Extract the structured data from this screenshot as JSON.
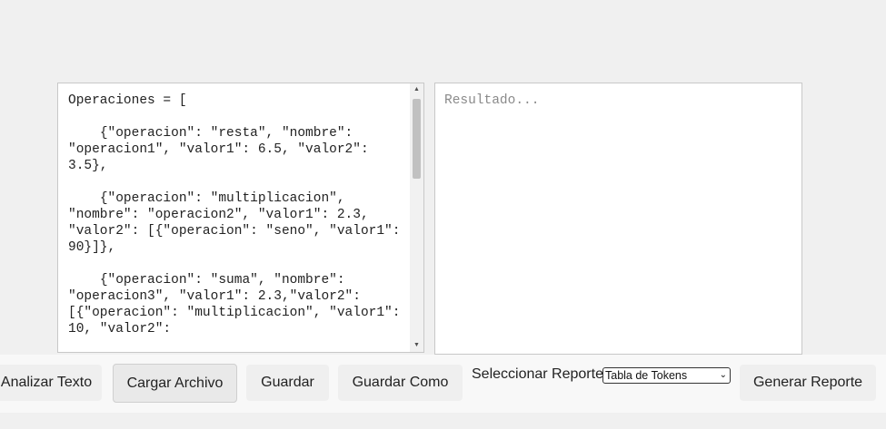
{
  "editor": {
    "content": "Operaciones = [\n\n    {\"operacion\": \"resta\", \"nombre\": \"operacion1\", \"valor1\": 6.5, \"valor2\": 3.5},\n\n    {\"operacion\": \"multiplicacion\", \"nombre\": \"operacion2\", \"valor1\": 2.3, \"valor2\": [{\"operacion\": \"seno\", \"valor1\": 90}]},\n\n    {\"operacion\": \"suma\", \"nombre\": \"operacion3\", \"valor1\": 2.3,\"valor2\": [{\"operacion\": \"multiplicacion\", \"valor1\": 10, \"valor2\":",
    "scroll_up_icon": "triangle-up",
    "scroll_down_icon": "triangle-down"
  },
  "result": {
    "placeholder": "Resultado..."
  },
  "toolbar": {
    "analizar_label": "Analizar Texto",
    "cargar_label": "Cargar Archivo",
    "guardar_label": "Guardar",
    "guardar_como_label": "Guardar Como",
    "report_label": "Seleccionar Reporte:",
    "report_selected": "Tabla de Tokens",
    "generar_label": "Generar Reporte"
  }
}
